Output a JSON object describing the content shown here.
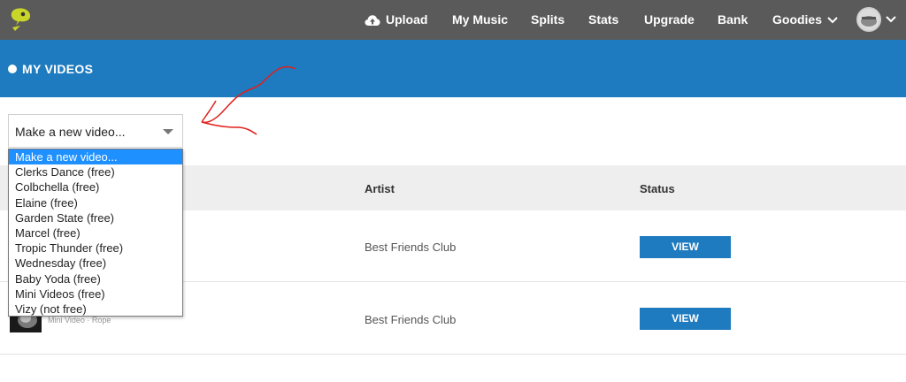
{
  "nav": {
    "upload": "Upload",
    "my_music": "My Music",
    "splits": "Splits",
    "stats": "Stats",
    "upgrade": "Upgrade",
    "bank": "Bank",
    "goodies": "Goodies"
  },
  "header": {
    "title": "MY VIDEOS"
  },
  "select": {
    "value": "Make a new video...",
    "options": [
      "Make a new video...",
      "Clerks Dance (free)",
      "Colbchella (free)",
      "Elaine (free)",
      "Garden State (free)",
      "Marcel (free)",
      "Tropic Thunder (free)",
      "Wednesday (free)",
      "Baby Yoda (free)",
      "Mini Videos (free)",
      "Vizy (not free)"
    ]
  },
  "table": {
    "headers": {
      "artist": "Artist",
      "status": "Status"
    },
    "rows": [
      {
        "artist": "Best Friends Club",
        "action": "VIEW"
      },
      {
        "artist": "Best Friends Club",
        "action": "VIEW",
        "meta": "Mini Video · Rope"
      }
    ]
  },
  "colors": {
    "nav_bg": "#5a5a5a",
    "accent": "#1e7bbf",
    "dropdown_highlight": "#1e90ff",
    "annotation": "#e0201b"
  }
}
